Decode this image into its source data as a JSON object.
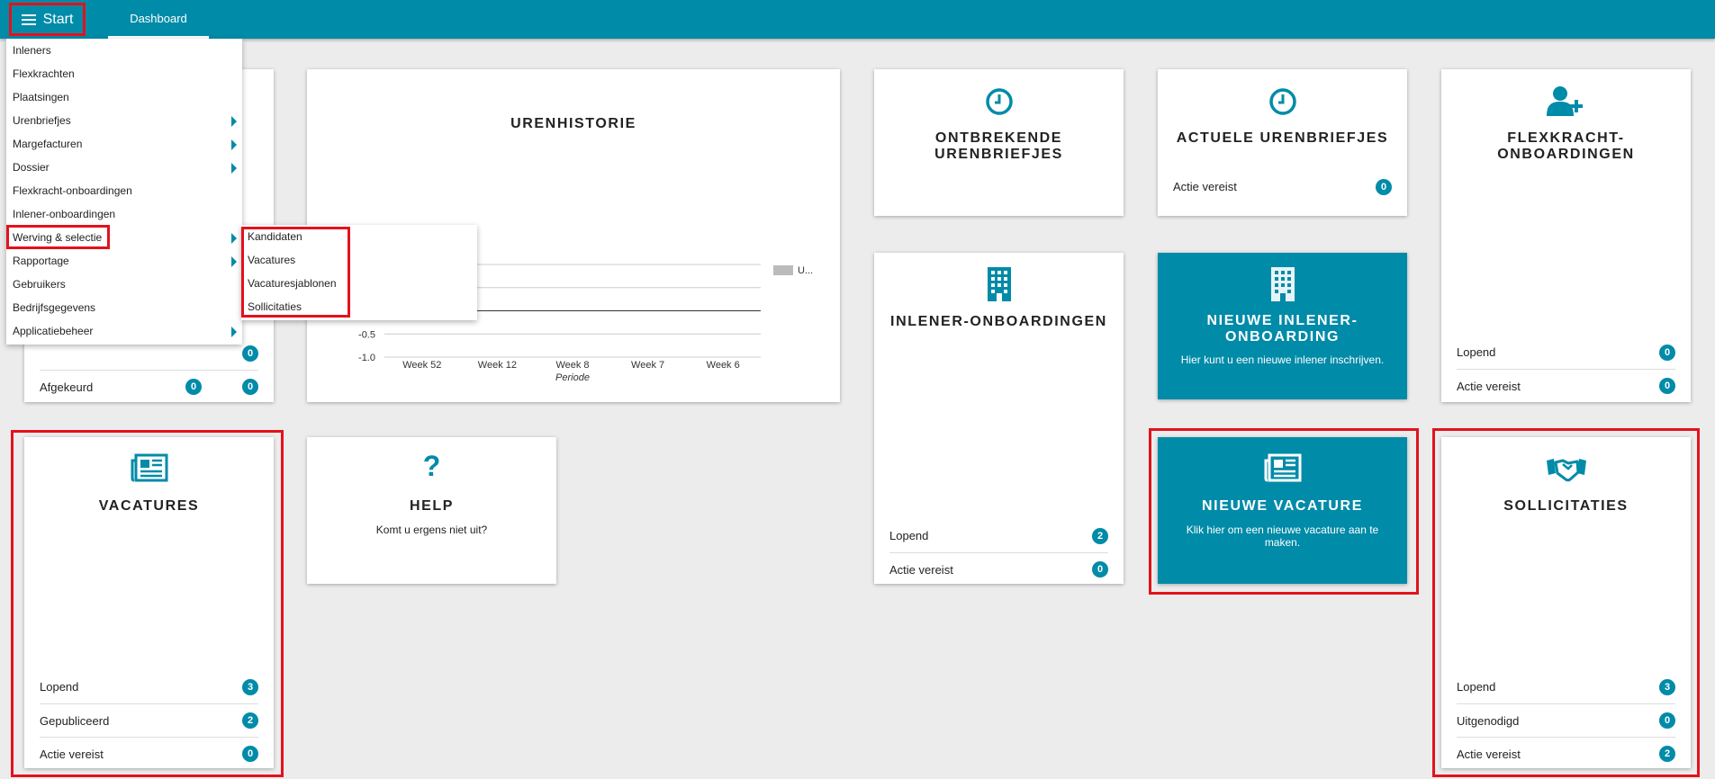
{
  "topbar": {
    "start_label": "Start",
    "dashboard_tab": "Dashboard"
  },
  "menu": {
    "items": [
      {
        "label": "Inleners"
      },
      {
        "label": "Flexkrachten"
      },
      {
        "label": "Plaatsingen"
      },
      {
        "label": "Urenbriefjes"
      },
      {
        "label": "Margefacturen"
      },
      {
        "label": "Dossier"
      },
      {
        "label": "Flexkracht-onboardingen"
      },
      {
        "label": "Inlener-onboardingen"
      },
      {
        "label": "Werving & selectie"
      },
      {
        "label": "Rapportage"
      },
      {
        "label": "Gebruikers"
      },
      {
        "label": "Bedrijfsgegevens"
      },
      {
        "label": "Applicatiebeheer"
      }
    ],
    "submenu": [
      {
        "label": "Kandidaten"
      },
      {
        "label": "Vacatures"
      },
      {
        "label": "Vacaturesjablonen"
      },
      {
        "label": "Sollicitaties"
      }
    ]
  },
  "colors": {
    "accent": "#008ba8",
    "highlight": "#e3121c",
    "background": "#ececec"
  },
  "cards": {
    "hidden_card": {
      "afgekeurd_label": "Afgekeurd",
      "afgekeurd_a": "0",
      "afgekeurd_b": "0",
      "row_above_b": "0"
    },
    "urenhistorie": {
      "title": "URENHISTORIE"
    },
    "ontbrekende": {
      "title": "ONTBREKENDE URENBRIEFJES",
      "icon": "clock-icon"
    },
    "actuele": {
      "title": "ACTUELE URENBRIEFJES",
      "icon": "clock-icon",
      "stat_label": "Actie vereist",
      "stat_value": "0"
    },
    "flexkracht_onboardingen": {
      "title": "FLEXKRACHT-ONBOARDINGEN",
      "icon": "user-plus-icon",
      "stats": [
        {
          "label": "Lopend",
          "value": "0"
        },
        {
          "label": "Actie vereist",
          "value": "0"
        }
      ]
    },
    "inlener_onboardingen": {
      "title": "INLENER-ONBOARDINGEN",
      "icon": "building-icon",
      "stats": [
        {
          "label": "Lopend",
          "value": "2"
        },
        {
          "label": "Actie vereist",
          "value": "0"
        }
      ]
    },
    "nieuwe_inlener": {
      "title": "NIEUWE INLENER-ONBOARDING",
      "subtitle": "Hier kunt u een nieuwe inlener inschrijven.",
      "icon": "building-icon"
    },
    "vacatures": {
      "title": "VACATURES",
      "icon": "newspaper-icon",
      "stats": [
        {
          "label": "Lopend",
          "value": "3"
        },
        {
          "label": "Gepubliceerd",
          "value": "2"
        },
        {
          "label": "Actie vereist",
          "value": "0"
        }
      ]
    },
    "help": {
      "title": "HELP",
      "subtitle": "Komt u ergens niet uit?",
      "icon": "question-icon"
    },
    "nieuwe_vacature": {
      "title": "NIEUWE VACATURE",
      "subtitle": "Klik hier om een nieuwe vacature aan te maken.",
      "icon": "newspaper-icon"
    },
    "sollicitaties": {
      "title": "SOLLICITATIES",
      "icon": "handshake-icon",
      "stats": [
        {
          "label": "Lopend",
          "value": "3"
        },
        {
          "label": "Uitgenodigd",
          "value": "0"
        },
        {
          "label": "Actie vereist",
          "value": "2"
        }
      ]
    }
  },
  "chart_data": {
    "type": "line",
    "title": "URENHISTORIE",
    "categories": [
      "Week 52",
      "Week 12",
      "Week 8",
      "Week 7",
      "Week 6"
    ],
    "xlabel": "Periode",
    "ylabel": "",
    "yticks": [
      "-0.5",
      "-1.0"
    ],
    "series": [
      {
        "name": "U...",
        "values": [
          0,
          0,
          0,
          0,
          0
        ],
        "color": "#bbbbbb"
      }
    ],
    "ylim": [
      -1,
      1
    ],
    "grid": true,
    "legend_position": "right"
  }
}
